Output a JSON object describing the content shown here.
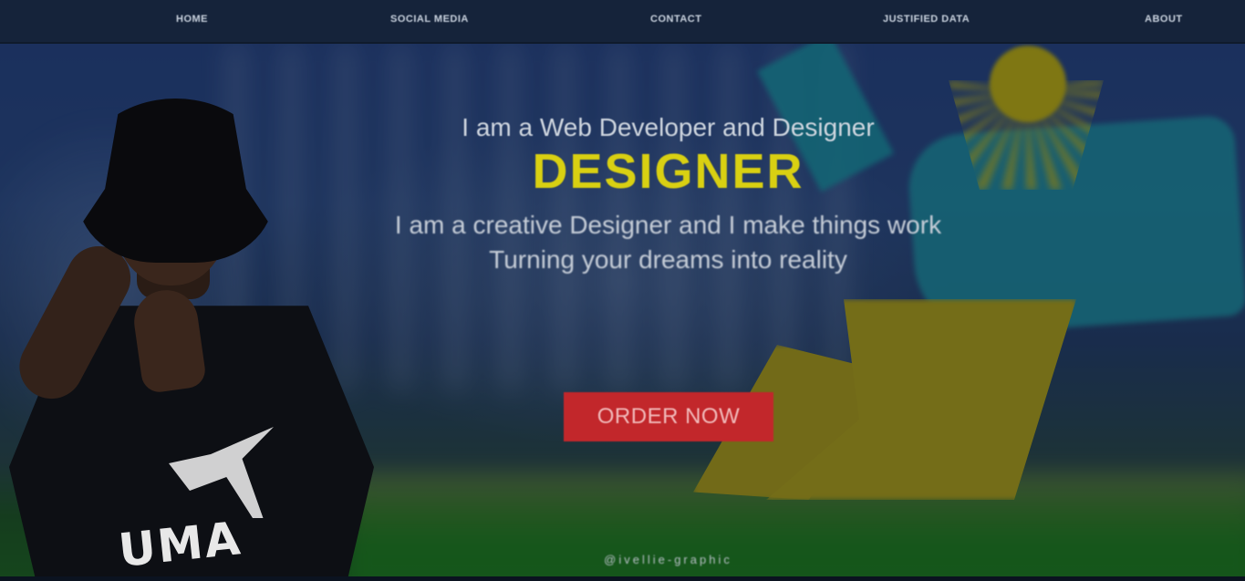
{
  "nav": {
    "items": [
      {
        "label": "HOME"
      },
      {
        "label": "SOCIAL MEDIA"
      },
      {
        "label": "CONTACT"
      },
      {
        "label": "JUSTIFIED DATA"
      },
      {
        "label": "ABOUT"
      }
    ]
  },
  "hero": {
    "tagline": "I am a Web Developer and Designer",
    "title": "DESIGNER",
    "description_line1": "I am a creative Designer and I make things work",
    "description_line2": "Turning your dreams into reality",
    "cta_label": "ORDER NOW",
    "credit": "@ivellie-graphic",
    "shirt_brand": "UMA"
  },
  "colors": {
    "nav_bg": "#15233a",
    "title_yellow": "#d9d012",
    "cta_red": "#c2272b"
  }
}
